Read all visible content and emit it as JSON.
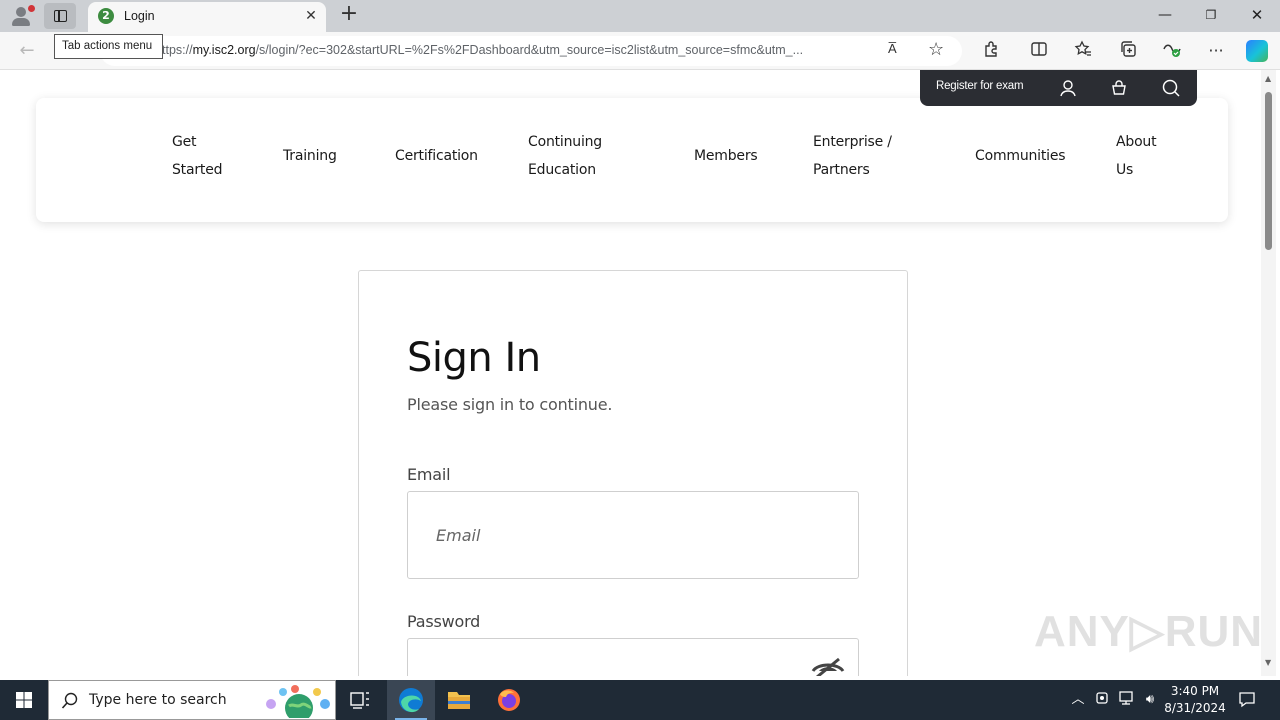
{
  "browser": {
    "tab": {
      "title": "Login",
      "favicon_text": "2"
    },
    "tooltip": "Tab actions menu",
    "url_prefix": "ttps://",
    "url_domain": "my.isc2.org",
    "url_path": "/s/login/?ec=302&startURL=%2Fs%2FDashboard&utm_source=isc2list&utm_source=sfmc&utm_...",
    "read_aloud": "A̅"
  },
  "site": {
    "utility": {
      "register": "Register for exam"
    },
    "nav": [
      {
        "line1": "Get",
        "line2": "Started"
      },
      {
        "line1": "Training",
        "line2": ""
      },
      {
        "line1": "Certification",
        "line2": ""
      },
      {
        "line1": "Continuing",
        "line2": "Education"
      },
      {
        "line1": "Members",
        "line2": ""
      },
      {
        "line1": "Enterprise /",
        "line2": "Partners"
      },
      {
        "line1": "Communities",
        "line2": ""
      },
      {
        "line1": "About",
        "line2": "Us"
      }
    ]
  },
  "signin": {
    "title": "Sign In",
    "subtitle": "Please sign in to continue.",
    "email_label": "Email",
    "email_placeholder": "Email",
    "password_label": "Password",
    "password_value": ""
  },
  "watermark": "ANY▷RUN",
  "taskbar": {
    "search_placeholder": "Type here to search",
    "time": "3:40 PM",
    "date": "8/31/2024"
  },
  "colors": {
    "util_bar": "#2b2d33",
    "taskbar": "#1f2a36",
    "edge_blue": "#0f7bd4",
    "accent": "#3d8c40"
  }
}
